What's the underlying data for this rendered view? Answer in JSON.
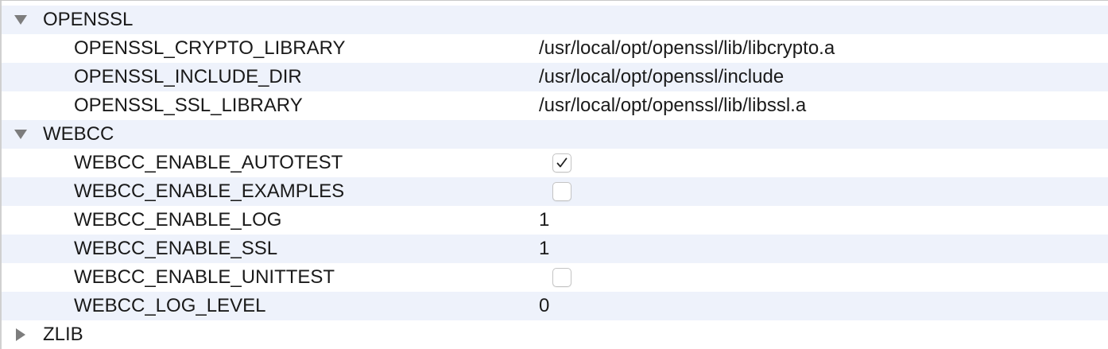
{
  "groups": [
    {
      "label": "OPENSSL",
      "expanded": true,
      "entries": [
        {
          "name": "OPENSSL_CRYPTO_LIBRARY",
          "value": "/usr/local/opt/openssl/lib/libcrypto.a"
        },
        {
          "name": "OPENSSL_INCLUDE_DIR",
          "value": "/usr/local/opt/openssl/include"
        },
        {
          "name": "OPENSSL_SSL_LIBRARY",
          "value": "/usr/local/opt/openssl/lib/libssl.a"
        }
      ]
    },
    {
      "label": "WEBCC",
      "expanded": true,
      "entries": [
        {
          "name": "WEBCC_ENABLE_AUTOTEST",
          "checked": true
        },
        {
          "name": "WEBCC_ENABLE_EXAMPLES",
          "checked": false
        },
        {
          "name": "WEBCC_ENABLE_LOG",
          "value": "1"
        },
        {
          "name": "WEBCC_ENABLE_SSL",
          "value": "1"
        },
        {
          "name": "WEBCC_ENABLE_UNITTEST",
          "checked": false
        },
        {
          "name": "WEBCC_LOG_LEVEL",
          "value": "0"
        }
      ]
    },
    {
      "label": "ZLIB",
      "expanded": false,
      "entries": []
    }
  ],
  "icons": {
    "expanded": "disclosure-triangle-down-icon",
    "collapsed": "disclosure-triangle-right-icon",
    "check": "checkmark-icon"
  },
  "colors": {
    "alt_row": "#eef2fb",
    "disclosure": "#7d7d7d"
  }
}
